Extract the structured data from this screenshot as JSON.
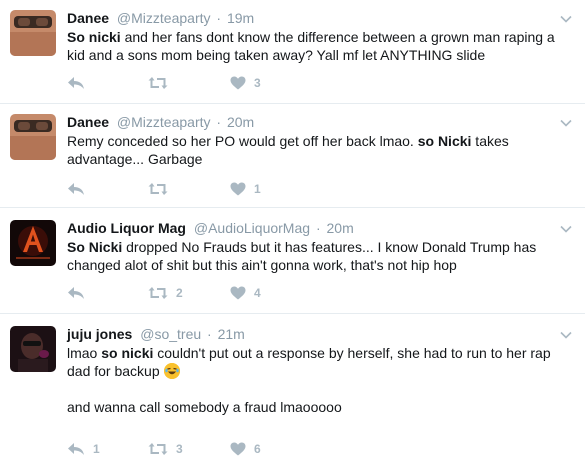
{
  "tweets": [
    {
      "name": "Danee",
      "handle": "@Mizzteaparty",
      "time": "19m",
      "text_b1": "So nicki",
      "text_1": " and her fans dont know the difference between a grown man raping a kid and a sons mom being taken away? Yall mf let ANYTHING slide",
      "reply_count": "",
      "retweet_count": "",
      "like_count": "3"
    },
    {
      "name": "Danee",
      "handle": "@Mizzteaparty",
      "time": "20m",
      "text_1": "Remy conceded so her PO would get off her back lmao. ",
      "text_b1": "so Nicki",
      "text_2": " takes advantage... Garbage",
      "reply_count": "",
      "retweet_count": "",
      "like_count": "1"
    },
    {
      "name": "Audio Liquor Mag",
      "handle": "@AudioLiquorMag",
      "time": "20m",
      "text_b1": "So Nicki",
      "text_1": " dropped No Frauds but it has features... I know Donald Trump has changed alot of shit but this ain't gonna work, that's not hip hop",
      "reply_count": "",
      "retweet_count": "2",
      "like_count": "4"
    },
    {
      "name": "juju jones",
      "handle": "@so_treu",
      "time": "21m",
      "text_1": "lmao ",
      "text_b1": "so nicki",
      "text_2": " couldn't put out a response by herself, she had to run to her rap dad for backup ",
      "text_3": "and wanna call somebody a fraud lmaooooo",
      "reply_count": "1",
      "retweet_count": "3",
      "like_count": "6"
    }
  ],
  "icons": {
    "reply": "reply-icon",
    "retweet": "retweet-icon",
    "like": "heart-icon",
    "more": "chevron-down-icon"
  },
  "colors": {
    "muted": "#8899a6",
    "icon": "#aab8c2",
    "divider": "#e6ecf0"
  }
}
